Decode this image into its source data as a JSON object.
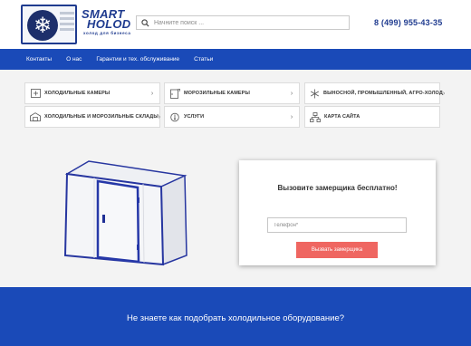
{
  "header": {
    "logo_line1": "SMART",
    "logo_line2": "HOLOD",
    "logo_tagline": "холод для бизнеса",
    "search_placeholder": "Начните поиск ...",
    "phone": "8 (499) 955-43-35"
  },
  "nav": {
    "items": [
      {
        "label": "Контакты"
      },
      {
        "label": "О нас"
      },
      {
        "label": "Гарантии и тех. обслуживание"
      },
      {
        "label": "Статьи"
      }
    ]
  },
  "categories": [
    {
      "label": "ХОЛОДИЛЬНЫЕ КАМЕРЫ",
      "icon": "cold-room-icon"
    },
    {
      "label": "МОРОЗИЛЬНЫЕ КАМЕРЫ",
      "icon": "freezer-icon"
    },
    {
      "label": "ВЫНОСНОЙ, ПРОМЫШЛЕННЫЙ, АГРО-ХОЛОД",
      "icon": "snowflake-icon"
    },
    {
      "label": "ХОЛОДИЛЬНЫЕ И МОРОЗИЛЬНЫЕ СКЛАДЫ",
      "icon": "warehouse-icon"
    },
    {
      "label": "УСЛУГИ",
      "icon": "thermometer-icon"
    },
    {
      "label": "КАРТА САЙТА",
      "icon": "sitemap-icon"
    }
  ],
  "form": {
    "title": "Вызовите замерщика бесплатно!",
    "phone_placeholder": "Телефон*",
    "submit_label": "Вызвать замерщика"
  },
  "banner": {
    "text": "Не знаете как подобрать холодильное оборудование?"
  },
  "colors": {
    "brand_blue": "#1a4ab8",
    "accent_red": "#ef6661"
  }
}
